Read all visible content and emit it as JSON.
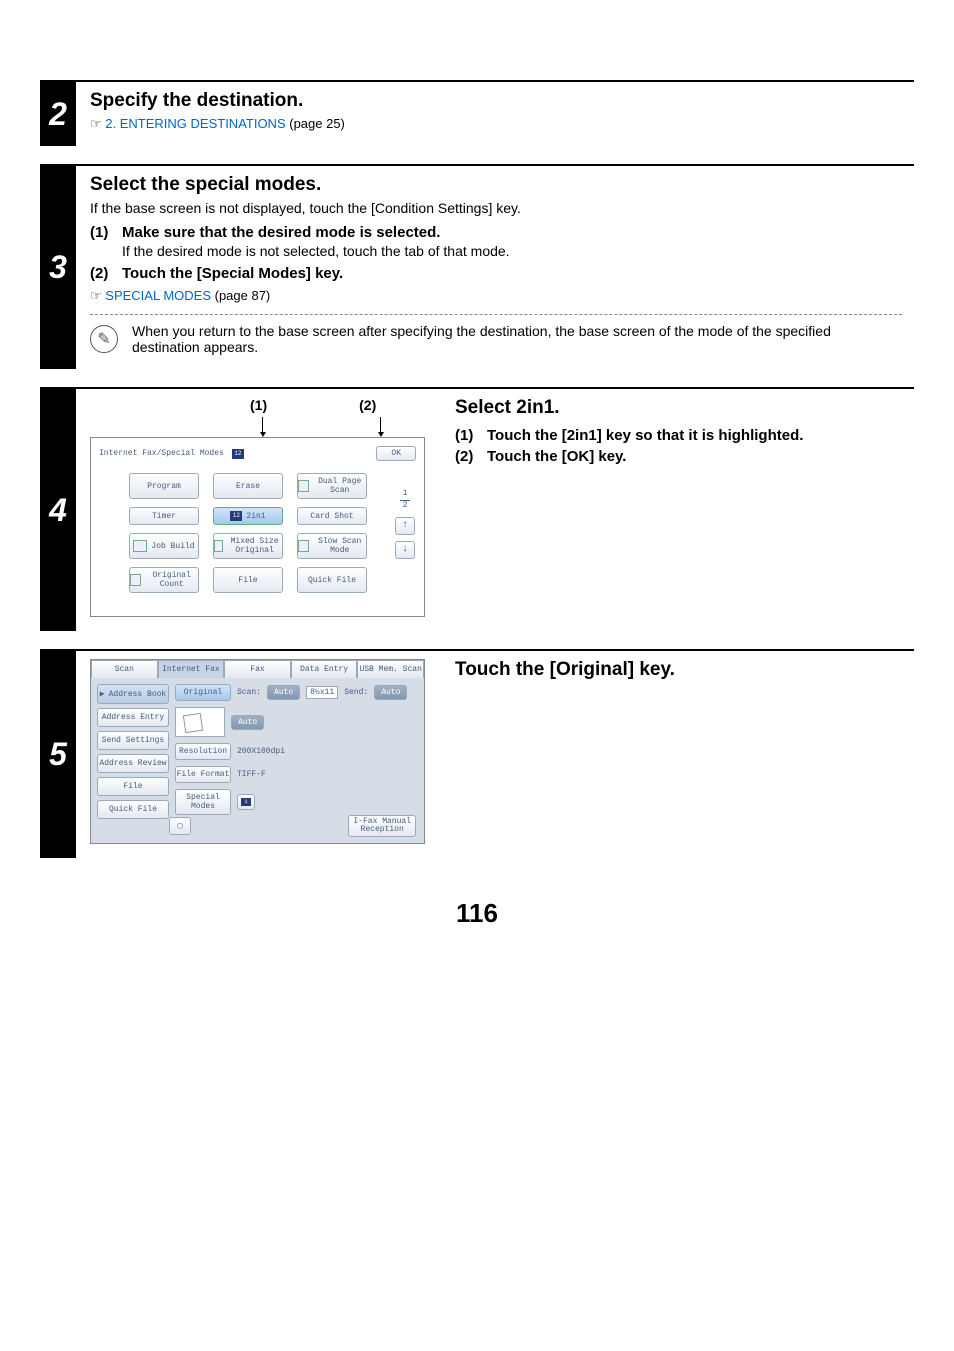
{
  "step2": {
    "num": "2",
    "title": "Specify the destination.",
    "pointer_prefix": "☞",
    "pointer_link": "2. ENTERING DESTINATIONS",
    "pointer_suffix": " (page 25)"
  },
  "step3": {
    "num": "3",
    "title": "Select the special modes.",
    "intro": "If the base screen is not displayed, touch the [Condition Settings] key.",
    "sub1_num": "(1)",
    "sub1_title": "Make sure that the desired mode is selected.",
    "sub1_desc": "If the desired mode is not selected, touch the tab of that mode.",
    "sub2_num": "(2)",
    "sub2_title": "Touch the [Special Modes] key.",
    "pointer_prefix": "☞",
    "pointer_link": "SPECIAL MODES",
    "pointer_suffix": " (page 87)",
    "note": "When you return to the base screen after specifying the destination, the base screen of the mode of the specified destination appears."
  },
  "step4": {
    "num": "4",
    "callout1": "(1)",
    "callout2": "(2)",
    "screen": {
      "title": "Internet Fax/Special Modes",
      "ok": "OK",
      "page_curr": "1",
      "page_total": "2",
      "buttons": {
        "program": "Program",
        "erase": "Erase",
        "dual_page": "Dual Page Scan",
        "timer": "Timer",
        "two_in_one": "2in1",
        "card_shot": "Card Shot",
        "job_build": "Job Build",
        "mixed_size": "Mixed Size Original",
        "slow_scan": "Slow Scan Mode",
        "orig_count": "Original Count",
        "file": "File",
        "quick_file": "Quick File"
      }
    },
    "right": {
      "title": "Select 2in1.",
      "sub1_num": "(1)",
      "sub1_title": "Touch the [2in1] key so that it is highlighted.",
      "sub2_num": "(2)",
      "sub2_title": "Touch the [OK] key."
    }
  },
  "step5": {
    "num": "5",
    "screen": {
      "tabs": {
        "scan": "Scan",
        "ifax": "Internet Fax",
        "fax": "Fax",
        "data": "Data Entry",
        "usb": "USB Mem. Scan"
      },
      "left": {
        "address_book": "Address Book",
        "address_entry": "Address Entry",
        "send_settings": "Send Settings",
        "address_review": "Address Review",
        "file": "File",
        "quick_file": "Quick File"
      },
      "rows": {
        "original": "Original",
        "scan_lbl": "Scan:",
        "scan_auto": "Auto",
        "scan_size": "8½x11",
        "send_lbl": "Send:",
        "send_auto": "Auto",
        "preview_auto": "Auto",
        "resolution": "Resolution",
        "resolution_val": "200X100dpi",
        "file_format": "File Format",
        "file_format_val": "TIFF-F",
        "special_modes": "Special Modes"
      },
      "bottom_right_l1": "I-Fax Manual",
      "bottom_right_l2": "Reception"
    },
    "right": {
      "title": "Touch the [Original] key."
    }
  },
  "page_number": "116"
}
